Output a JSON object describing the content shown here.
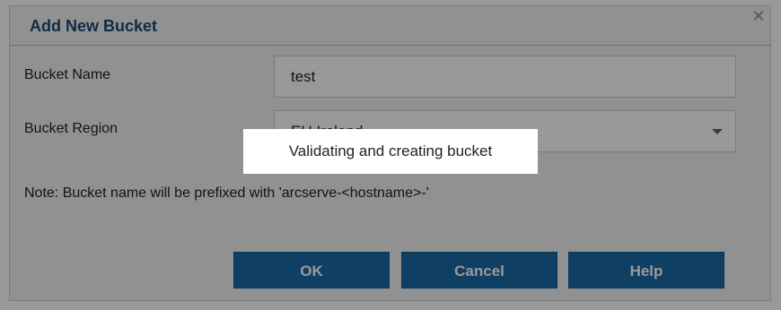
{
  "dialog": {
    "title": "Add New Bucket",
    "close_icon": "close-icon"
  },
  "form": {
    "bucket_name_label": "Bucket Name",
    "bucket_name_value": "test",
    "bucket_region_label": "Bucket Region",
    "bucket_region_value": "EU Ireland"
  },
  "note": "Note: Bucket name will be prefixed with 'arcserve-<hostname>-'",
  "buttons": {
    "ok": "OK",
    "cancel": "Cancel",
    "help": "Help"
  },
  "toast": {
    "message": "Validating and creating bucket"
  },
  "colors": {
    "title": "#1a4a78",
    "button": "#1a6aa6",
    "overlay": "rgba(0,0,0,0.40)"
  }
}
